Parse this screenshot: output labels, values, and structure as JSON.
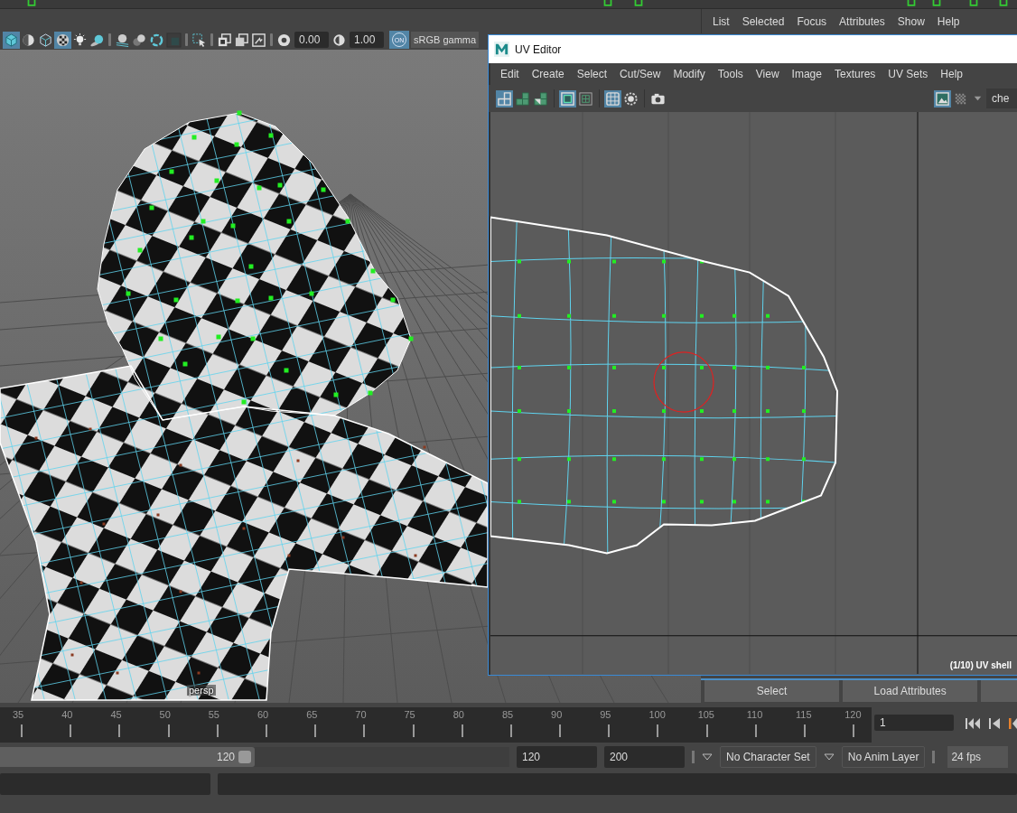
{
  "viewport": {
    "toolbar": {
      "groups": [
        [
          {
            "kind": "cube",
            "on": true
          },
          {
            "kind": "half-sphere",
            "on": false
          },
          {
            "kind": "wire-cube",
            "on": false
          },
          {
            "kind": "checker-sphere",
            "on": true
          },
          {
            "kind": "bulb",
            "on": false
          },
          {
            "kind": "shadow-sphere",
            "on": false
          }
        ],
        [
          {
            "kind": "sphere-plane",
            "on": false
          },
          {
            "kind": "spheres",
            "on": false
          },
          {
            "kind": "ring",
            "on": false
          },
          {
            "kind": "dark-square",
            "on": false
          }
        ],
        [
          {
            "kind": "select-cursor",
            "on": false
          }
        ],
        [
          {
            "kind": "squares",
            "on": false
          },
          {
            "kind": "square-overlap",
            "on": false
          },
          {
            "kind": "image-frame",
            "on": false
          }
        ]
      ],
      "exposure": "0.00",
      "gamma": "1.00",
      "view_transform": {
        "label": "ON",
        "on": true
      },
      "color_space": "sRGB gamma"
    },
    "camera_label": "persp"
  },
  "outliner_menu": [
    "List",
    "Selected",
    "Focus",
    "Attributes",
    "Show",
    "Help"
  ],
  "uv_editor": {
    "title": "UV Editor",
    "menu": [
      "Edit",
      "Create",
      "Select",
      "Cut/Sew",
      "Modify",
      "Tools",
      "View",
      "Image",
      "Textures",
      "UV Sets",
      "Help"
    ],
    "toolbar_groups": [
      [
        {
          "kind": "shell-outline",
          "on": true
        },
        {
          "kind": "shell-green",
          "on": false
        },
        {
          "kind": "shell-half",
          "on": false
        }
      ],
      [
        {
          "kind": "frame",
          "on": true
        },
        {
          "kind": "frame-dark",
          "on": false
        }
      ],
      [
        {
          "kind": "grid",
          "on": true
        },
        {
          "kind": "dashed-circle",
          "on": false
        }
      ],
      [
        {
          "kind": "camera",
          "on": false
        }
      ]
    ],
    "display_buttons": [
      {
        "kind": "image",
        "on": true
      },
      {
        "kind": "checker",
        "on": false
      }
    ],
    "texture_field": "che",
    "status": "(1/10) UV shell"
  },
  "attribute_buttons": [
    "Select",
    "Load Attributes"
  ],
  "timeline": {
    "frames": [
      "35",
      "40",
      "45",
      "50",
      "55",
      "60",
      "65",
      "70",
      "75",
      "80",
      "85",
      "90",
      "95",
      "100",
      "105",
      "110",
      "115",
      "120"
    ],
    "current_frame": "1"
  },
  "range": {
    "slider_end": "120",
    "level": 0.5,
    "end_time": "120",
    "max_time": "200",
    "character_set": "No Character Set",
    "anim_layer": "No Anim Layer",
    "fps": "24 fps"
  }
}
